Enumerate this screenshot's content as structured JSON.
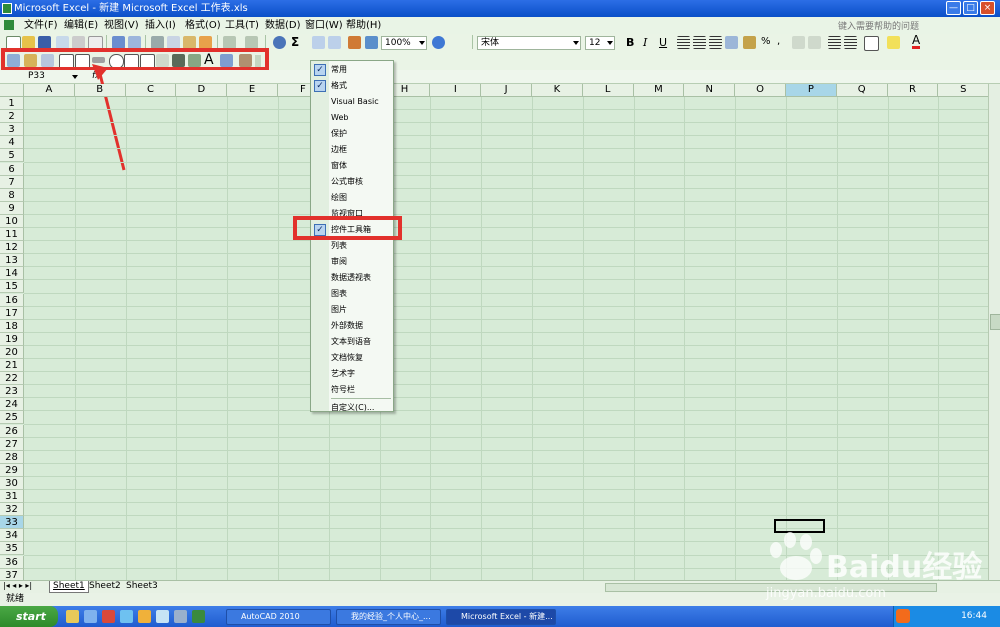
{
  "window": {
    "title": "Microsoft Excel - 新建 Microsoft Excel 工作表.xls",
    "controls": [
      "—",
      "□",
      "×"
    ]
  },
  "menubar": {
    "items": [
      "文件(F)",
      "编辑(E)",
      "视图(V)",
      "插入(I)",
      "格式(O)",
      "工具(T)",
      "数据(D)",
      "窗口(W)",
      "帮助(H)"
    ],
    "help_placeholder": "键入需要帮助的问题"
  },
  "toolbar": {
    "zoom": "100%",
    "font": "宋体",
    "font_size": "12"
  },
  "formula": {
    "name_box": "P33",
    "fx": "fx"
  },
  "columns": [
    "A",
    "B",
    "C",
    "D",
    "E",
    "F",
    "G",
    "H",
    "I",
    "J",
    "K",
    "L",
    "M",
    "N",
    "O",
    "P",
    "Q",
    "R",
    "S"
  ],
  "rows": [
    "1",
    "2",
    "3",
    "4",
    "5",
    "6",
    "7",
    "8",
    "9",
    "10",
    "11",
    "12",
    "13",
    "14",
    "15",
    "16",
    "17",
    "18",
    "19",
    "20",
    "21",
    "22",
    "23",
    "24",
    "25",
    "26",
    "27",
    "28",
    "29",
    "30",
    "31",
    "32",
    "33",
    "34",
    "35",
    "36",
    "37"
  ],
  "context_menu": {
    "items": [
      {
        "label": "常用",
        "checked": true
      },
      {
        "label": "格式",
        "checked": true
      },
      {
        "label": "Visual Basic",
        "checked": false
      },
      {
        "label": "Web",
        "checked": false
      },
      {
        "label": "保护",
        "checked": false
      },
      {
        "label": "边框",
        "checked": false
      },
      {
        "label": "窗体",
        "checked": false
      },
      {
        "label": "公式审核",
        "checked": false
      },
      {
        "label": "绘图",
        "checked": false
      },
      {
        "label": "监视窗口",
        "checked": false
      },
      {
        "label": "控件工具箱",
        "checked": true
      },
      {
        "label": "列表",
        "checked": false
      },
      {
        "label": "审阅",
        "checked": false
      },
      {
        "label": "数据透视表",
        "checked": false
      },
      {
        "label": "图表",
        "checked": false
      },
      {
        "label": "图片",
        "checked": false
      },
      {
        "label": "外部数据",
        "checked": false
      },
      {
        "label": "文本到语音",
        "checked": false
      },
      {
        "label": "文档恢复",
        "checked": false
      },
      {
        "label": "艺术字",
        "checked": false
      },
      {
        "label": "符号栏",
        "checked": false
      },
      {
        "label": "自定义(C)...",
        "checked": false
      }
    ]
  },
  "sheets": [
    "Sheet1",
    "Sheet2",
    "Sheet3"
  ],
  "status": "就绪",
  "taskbar": {
    "start": "start",
    "tasks": [
      "AutoCAD 2010",
      "我的经验_个人中心_...",
      "Microsoft Excel - 新建..."
    ],
    "clock": "16:44"
  },
  "watermark": {
    "brand": "Baidu经验",
    "url": "jingyan.baidu.com"
  },
  "colors": {
    "sheet_bg": "#d7ebd7",
    "highlight_red": "#e2312c",
    "selected_col": "#a8d6e8"
  }
}
